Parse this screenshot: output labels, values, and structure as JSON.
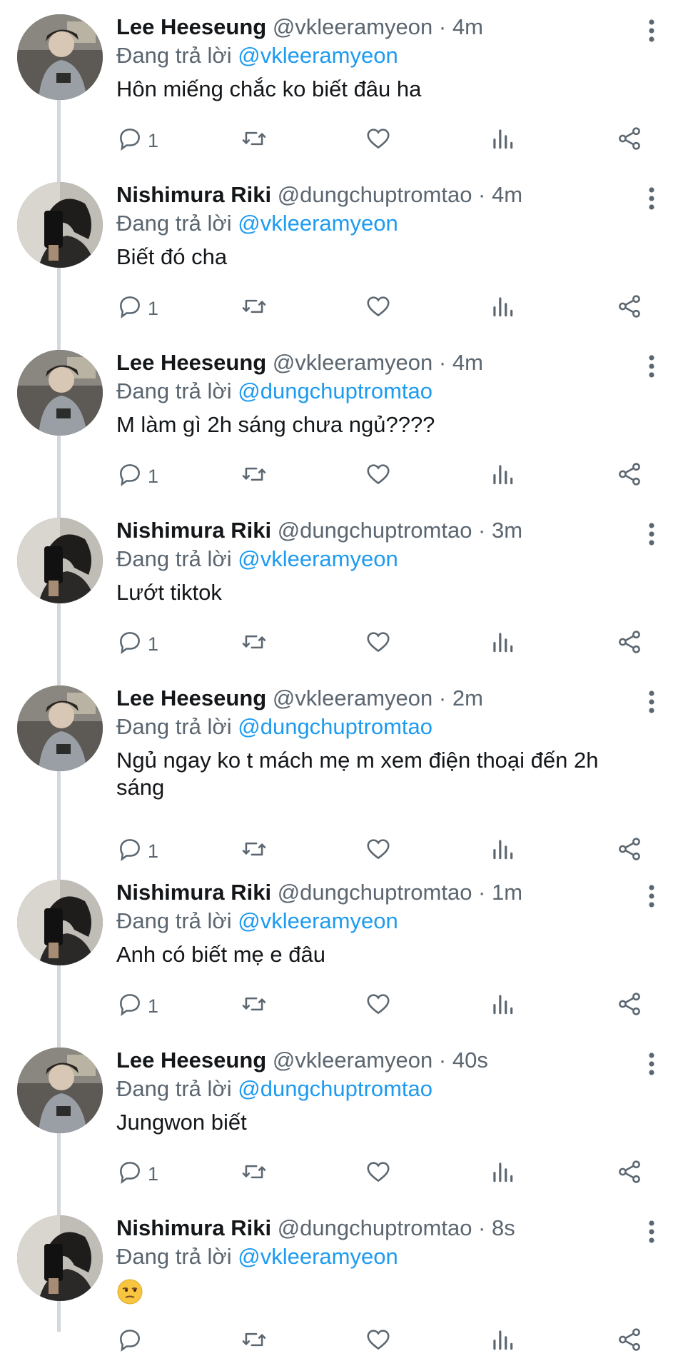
{
  "reply_prefix": "Đang trả lời",
  "tweets": [
    {
      "name": "Lee Heeseung",
      "handle": "@vkleeramyeon",
      "sep": " · ",
      "time": "4m",
      "reply_to": "@vkleeramyeon",
      "text": "Hôn miếng chắc ko biết đâu ha",
      "reply_count": "1"
    },
    {
      "name": "Nishimura Riki",
      "handle": "@dungchuptromtao",
      "sep": " · ",
      "time": "4m",
      "reply_to": "@vkleeramyeon",
      "text": "Biết đó cha",
      "reply_count": "1"
    },
    {
      "name": "Lee Heeseung",
      "handle": "@vkleeramyeon",
      "sep": " · ",
      "time": "4m",
      "reply_to": "@dungchuptromtao",
      "text": "M làm gì 2h sáng chưa ngủ????",
      "reply_count": "1"
    },
    {
      "name": "Nishimura Riki",
      "handle": "@dungchuptromtao",
      "sep": " · ",
      "time": "3m",
      "reply_to": "@vkleeramyeon",
      "text": "Lướt tiktok",
      "reply_count": "1"
    },
    {
      "name": "Lee Heeseung",
      "handle": "@vkleeramyeon",
      "sep": " · ",
      "time": "2m",
      "reply_to": "@dungchuptromtao",
      "text": "Ngủ ngay ko t mách mẹ m xem điện thoại đến 2h sáng",
      "reply_count": "1"
    },
    {
      "name": "Nishimura Riki",
      "handle": "@dungchuptromtao",
      "sep": " · ",
      "time": "1m",
      "reply_to": "@vkleeramyeon",
      "text": "Anh có biết mẹ e đâu",
      "reply_count": "1"
    },
    {
      "name": "Lee Heeseung",
      "handle": "@vkleeramyeon",
      "sep": " · ",
      "time": "40s",
      "reply_to": "@dungchuptromtao",
      "text": "Jungwon biết",
      "reply_count": "1"
    },
    {
      "name": "Nishimura Riki",
      "handle": "@dungchuptromtao",
      "sep": " · ",
      "time": "8s",
      "reply_to": "@vkleeramyeon",
      "text": "",
      "emoji": "unamused-face-emoji",
      "reply_count": ""
    }
  ],
  "colors": {
    "accent": "#1d9bf0",
    "text": "#14171a",
    "muted": "#5b6670",
    "thread_line": "#d4d8dc"
  },
  "icons": [
    "reply-icon",
    "retweet-icon",
    "like-icon",
    "analytics-icon",
    "share-icon",
    "more-icon"
  ]
}
